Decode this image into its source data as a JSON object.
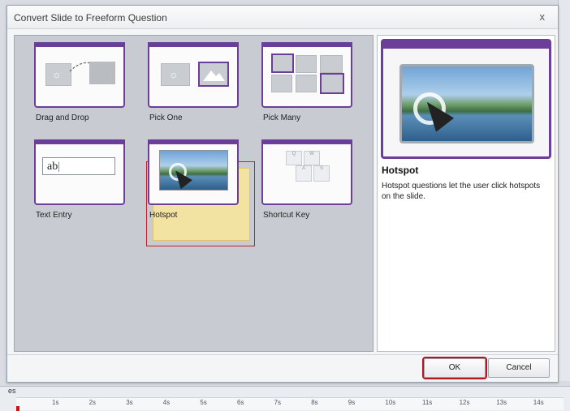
{
  "dialog": {
    "title": "Convert Slide to Freeform Question",
    "close_glyph": "x"
  },
  "question_types": [
    {
      "label": "Drag and Drop",
      "icon": "drag-drop-icon"
    },
    {
      "label": "Pick One",
      "icon": "pick-one-icon"
    },
    {
      "label": "Pick Many",
      "icon": "pick-many-icon"
    },
    {
      "label": "Text Entry",
      "icon": "text-entry-icon"
    },
    {
      "label": "Hotspot",
      "icon": "hotspot-icon"
    },
    {
      "label": "Shortcut Key",
      "icon": "shortcut-key-icon"
    }
  ],
  "text_entry_sample": "ab",
  "shortcut_keys": [
    "Q",
    "W",
    "A",
    "S"
  ],
  "selected_index": 4,
  "preview": {
    "title": "Hotspot",
    "description": "Hotspot questions let the user click hotspots on the slide."
  },
  "buttons": {
    "ok": "OK",
    "cancel": "Cancel"
  },
  "timeline": {
    "label": "es",
    "ticks": [
      "1s",
      "2s",
      "3s",
      "4s",
      "5s",
      "6s",
      "7s",
      "8s",
      "9s",
      "10s",
      "11s",
      "12s",
      "13s",
      "14s"
    ]
  },
  "colors": {
    "accent_purple": "#6b3f99",
    "selection_red": "#c0202a",
    "selection_yellow": "#f3e3a3"
  }
}
